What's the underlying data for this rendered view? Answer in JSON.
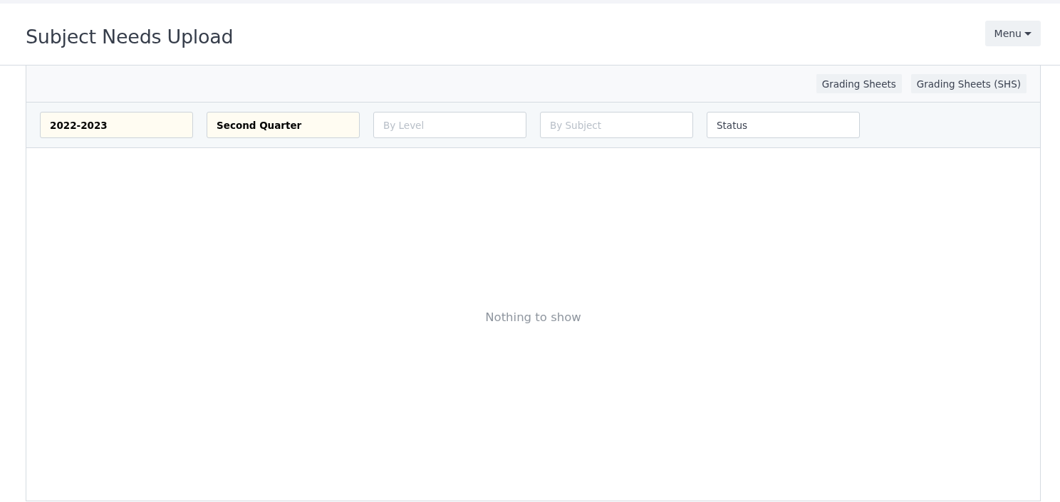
{
  "header": {
    "title": "Subject Needs Upload",
    "menu_button": "Menu"
  },
  "toolbar": {
    "buttons": [
      "Grading Sheets",
      "Grading Sheets (SHS)"
    ]
  },
  "filters": [
    {
      "value": "2022-2023",
      "active": true
    },
    {
      "value": "Second Quarter",
      "active": true
    },
    {
      "placeholder": "By Level",
      "active": false
    },
    {
      "placeholder": "By Subject",
      "active": false
    },
    {
      "value": "Status",
      "active": false
    }
  ],
  "empty_message": "Nothing to show"
}
